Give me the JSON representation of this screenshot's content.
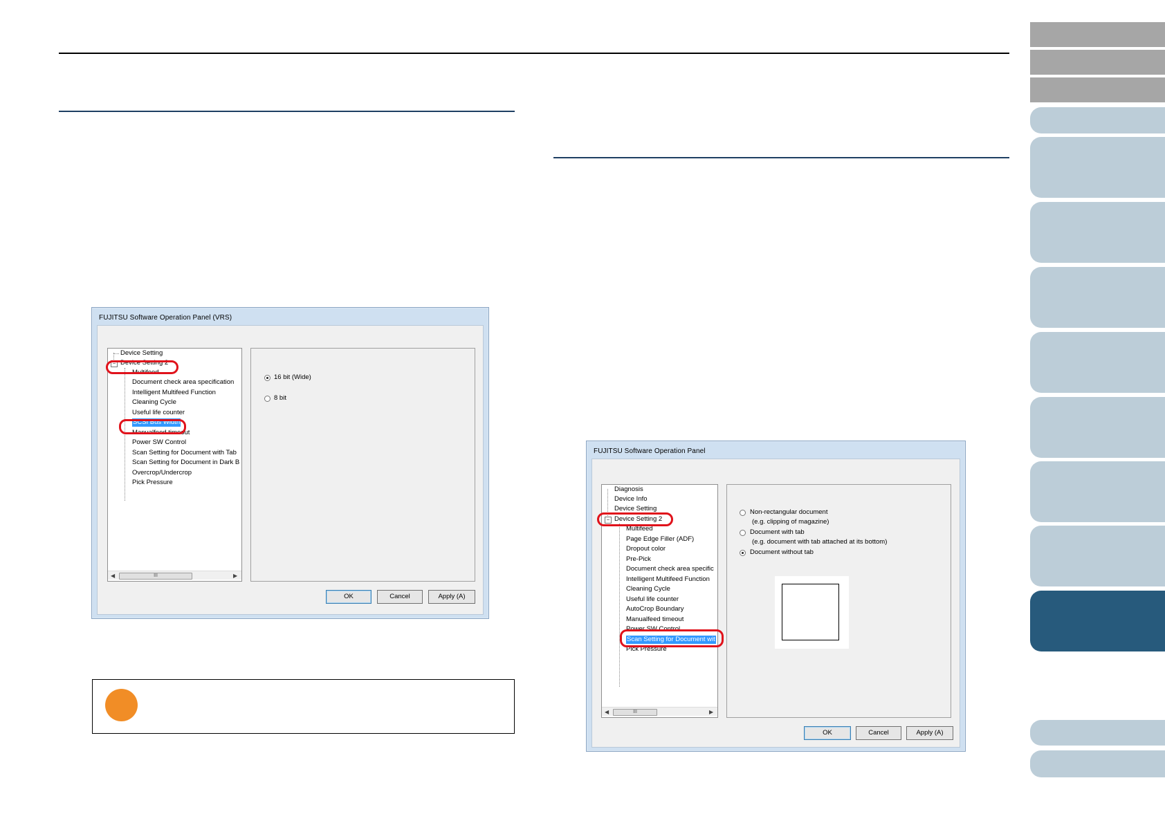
{
  "dialog_vrs": {
    "title": "FUJITSU Software Operation Panel (VRS)",
    "tree": [
      "Device Setting",
      "Device Setting 2",
      "Multifeed",
      "Document check area specification",
      "Intelligent Multifeed Function",
      "Cleaning Cycle",
      "Useful life counter",
      "SCSI Bus Width",
      "Manualfeed timeout",
      "Power SW Control",
      "Scan Setting for Document with Tab",
      "Scan Setting for Document in Dark B",
      "Overcrop/Undercrop",
      "Pick Pressure"
    ],
    "options": [
      "16 bit (Wide)",
      "8 bit"
    ],
    "selected_option": "16 bit (Wide)",
    "buttons": {
      "ok": "OK",
      "cancel": "Cancel",
      "apply": "Apply (A)"
    },
    "scroll_thumb": "III"
  },
  "dialog_main": {
    "title": "FUJITSU Software Operation Panel",
    "tree": [
      "Diagnosis",
      "Device Info",
      "Device Setting",
      "Device Setting 2",
      "Multifeed",
      "Page Edge Filler (ADF)",
      "Dropout color",
      "Pre-Pick",
      "Document check area specific",
      "Intelligent Multifeed Function",
      "Cleaning Cycle",
      "Useful life counter",
      "AutoCrop Boundary",
      "Manualfeed timeout",
      "Power SW Control",
      "Scan Setting for Document wit",
      "Pick Pressure"
    ],
    "options": [
      {
        "label": "Non-rectangular document",
        "sub": "(e.g. clipping of magazine)"
      },
      {
        "label": "Document with tab",
        "sub": "(e.g. document with tab attached at its bottom)"
      },
      {
        "label": "Document without tab",
        "sub": ""
      }
    ],
    "selected_option": "Document without tab",
    "buttons": {
      "ok": "OK",
      "cancel": "Cancel",
      "apply": "Apply (A)"
    },
    "scroll_thumb": "III"
  },
  "colors": {
    "rule": "#1e3f63",
    "highlight": "#e0121b",
    "caution": "#f18d26",
    "tab_active": "#275a7c",
    "tab_inactive": "#bccdd8"
  },
  "icons": {
    "caution": "caution-icon"
  }
}
